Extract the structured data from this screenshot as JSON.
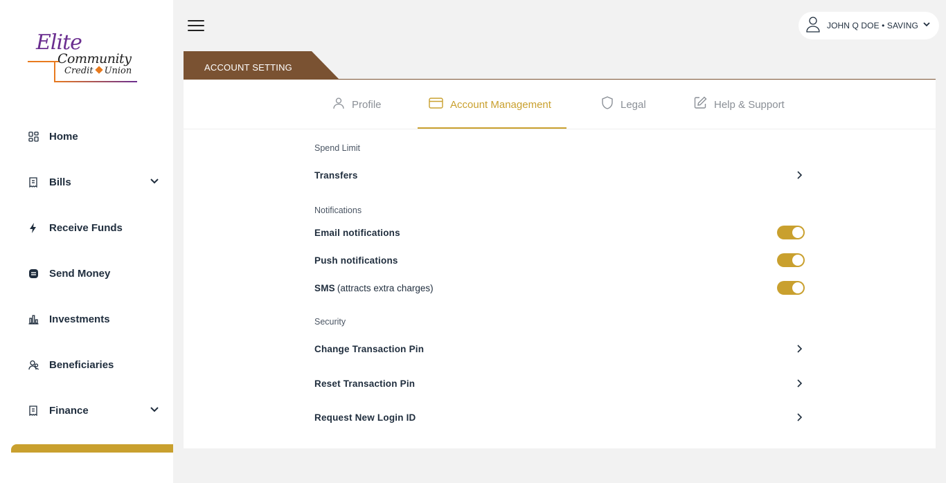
{
  "brand": {
    "logo_line1": "Elite",
    "logo_line2": "Community",
    "logo_line3a": "Credit",
    "logo_line3b": "Union"
  },
  "sidebar": {
    "items": [
      {
        "label": "Home",
        "icon": "home-grid-icon"
      },
      {
        "label": "Bills",
        "icon": "receipt-icon",
        "expandable": true
      },
      {
        "label": "Receive Funds",
        "icon": "bolt-icon"
      },
      {
        "label": "Send Money",
        "icon": "money-icon"
      },
      {
        "label": "Investments",
        "icon": "bar-chart-icon"
      },
      {
        "label": "Beneficiaries",
        "icon": "users-icon"
      },
      {
        "label": "Finance",
        "icon": "receipt-icon",
        "expandable": true
      }
    ]
  },
  "topbar": {
    "user_label": "JOHN Q DOE • SAVING"
  },
  "page": {
    "header_title": "ACCOUNT SETTING",
    "tabs": [
      {
        "label": "Profile",
        "icon": "user-icon",
        "active": false
      },
      {
        "label": "Account Management",
        "icon": "card-icon",
        "active": true
      },
      {
        "label": "Legal",
        "icon": "shield-icon",
        "active": false
      },
      {
        "label": "Help & Support",
        "icon": "edit-icon",
        "active": false
      }
    ]
  },
  "settings": {
    "spend_limit": {
      "title": "Spend Limit",
      "transfers": "Transfers"
    },
    "notifications": {
      "title": "Notifications",
      "email": "Email notifications",
      "push": "Push notifications",
      "sms": "SMS",
      "sms_note": "(attracts extra charges)",
      "email_on": true,
      "push_on": true,
      "sms_on": true
    },
    "security": {
      "title": "Security",
      "change_pin": "Change Transaction Pin",
      "reset_pin": "Reset Transaction Pin",
      "request_login": "Request New Login ID"
    }
  },
  "colors": {
    "accent": "#c9a02e",
    "header_brown": "#7a5232",
    "text": "#1f2d3d",
    "muted": "#8a8f96"
  }
}
